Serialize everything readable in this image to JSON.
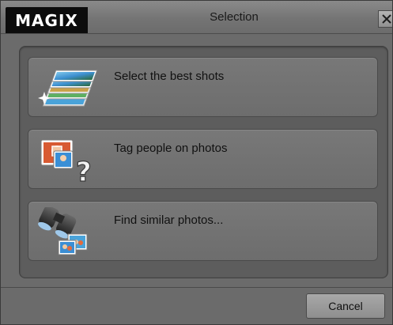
{
  "window": {
    "logo_text": "MAGIX",
    "title": "Selection",
    "close_icon": "close-icon"
  },
  "options": [
    {
      "label": "Select the best shots",
      "icon": "photo-stack-icon"
    },
    {
      "label": "Tag people on photos",
      "icon": "tag-people-icon"
    },
    {
      "label": "Find similar photos...",
      "icon": "binoculars-icon"
    }
  ],
  "footer": {
    "cancel_label": "Cancel"
  },
  "colors": {
    "window_bg": "#6b6b6b",
    "panel_bg": "#5d5d5d",
    "button_bg": "#747474",
    "logo_bg": "#0c0c0c"
  }
}
